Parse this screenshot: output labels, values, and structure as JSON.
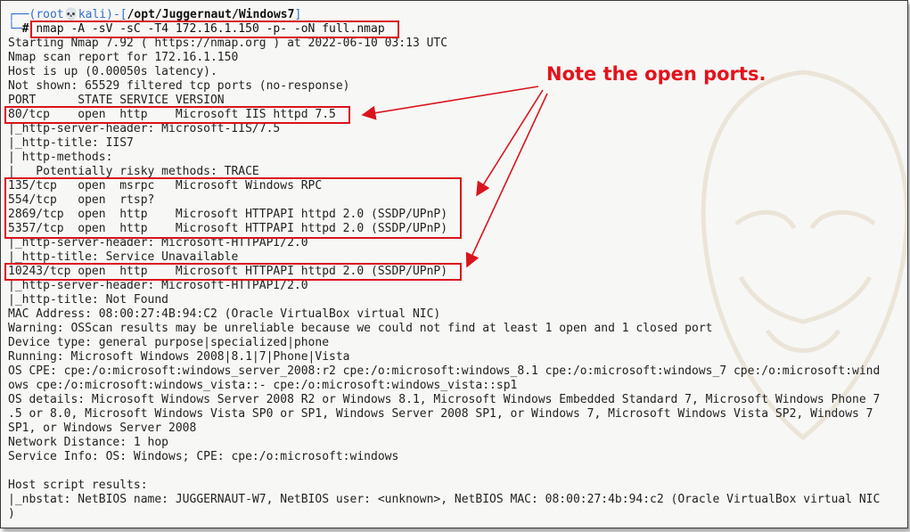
{
  "terminal": {
    "prompt": {
      "corner_top": "┌──(",
      "user": "root",
      "skull": "💀",
      "host": "kali",
      "separator": ")-[",
      "path": "/opt/Juggernaut/Windows7",
      "close": "]",
      "corner_bottom": "└─",
      "hash": "#"
    },
    "command": "nmap -A -sV -sC -T4 172.16.1.150 -p- -oN full.nmap",
    "output": [
      "Starting Nmap 7.92 ( https://nmap.org ) at 2022-06-10 03:13 UTC",
      "Nmap scan report for 172.16.1.150",
      "Host is up (0.00050s latency).",
      "Not shown: 65529 filtered tcp ports (no-response)",
      "PORT      STATE SERVICE VERSION",
      "80/tcp    open  http    Microsoft IIS httpd 7.5",
      "|_http-server-header: Microsoft-IIS/7.5",
      "|_http-title: IIS7",
      "| http-methods:",
      "|   Potentially risky methods: TRACE",
      "135/tcp   open  msrpc   Microsoft Windows RPC",
      "554/tcp   open  rtsp?",
      "2869/tcp  open  http    Microsoft HTTPAPI httpd 2.0 (SSDP/UPnP)",
      "5357/tcp  open  http    Microsoft HTTPAPI httpd 2.0 (SSDP/UPnP)",
      "|_http-server-header: Microsoft-HTTPAPI/2.0",
      "|_http-title: Service Unavailable",
      "10243/tcp open  http    Microsoft HTTPAPI httpd 2.0 (SSDP/UPnP)",
      "|_http-server-header: Microsoft-HTTPAPI/2.0",
      "|_http-title: Not Found",
      "MAC Address: 08:00:27:4B:94:C2 (Oracle VirtualBox virtual NIC)",
      "Warning: OSScan results may be unreliable because we could not find at least 1 open and 1 closed port",
      "Device type: general purpose|specialized|phone",
      "Running: Microsoft Windows 2008|8.1|7|Phone|Vista",
      "OS CPE: cpe:/o:microsoft:windows_server_2008:r2 cpe:/o:microsoft:windows_8.1 cpe:/o:microsoft:windows_7 cpe:/o:microsoft:wind",
      "ows cpe:/o:microsoft:windows_vista::- cpe:/o:microsoft:windows_vista::sp1",
      "OS details: Microsoft Windows Server 2008 R2 or Windows 8.1, Microsoft Windows Embedded Standard 7, Microsoft Windows Phone 7",
      ".5 or 8.0, Microsoft Windows Vista SP0 or SP1, Windows Server 2008 SP1, or Windows 7, Microsoft Windows Vista SP2, Windows 7",
      "SP1, or Windows Server 2008",
      "Network Distance: 1 hop",
      "Service Info: OS: Windows; CPE: cpe:/o:microsoft:windows",
      "",
      "Host script results:",
      "|_nbstat: NetBIOS name: JUGGERNAUT-W7, NetBIOS user: <unknown>, NetBIOS MAC: 08:00:27:4b:94:c2 (Oracle VirtualBox virtual NIC",
      ")"
    ]
  },
  "annotation": {
    "text": "Note the open ports."
  },
  "colors": {
    "annotation": "#e4121b",
    "prompt_blue": "#2f6fd0",
    "text": "#222222",
    "background": "#f7f7f5"
  }
}
